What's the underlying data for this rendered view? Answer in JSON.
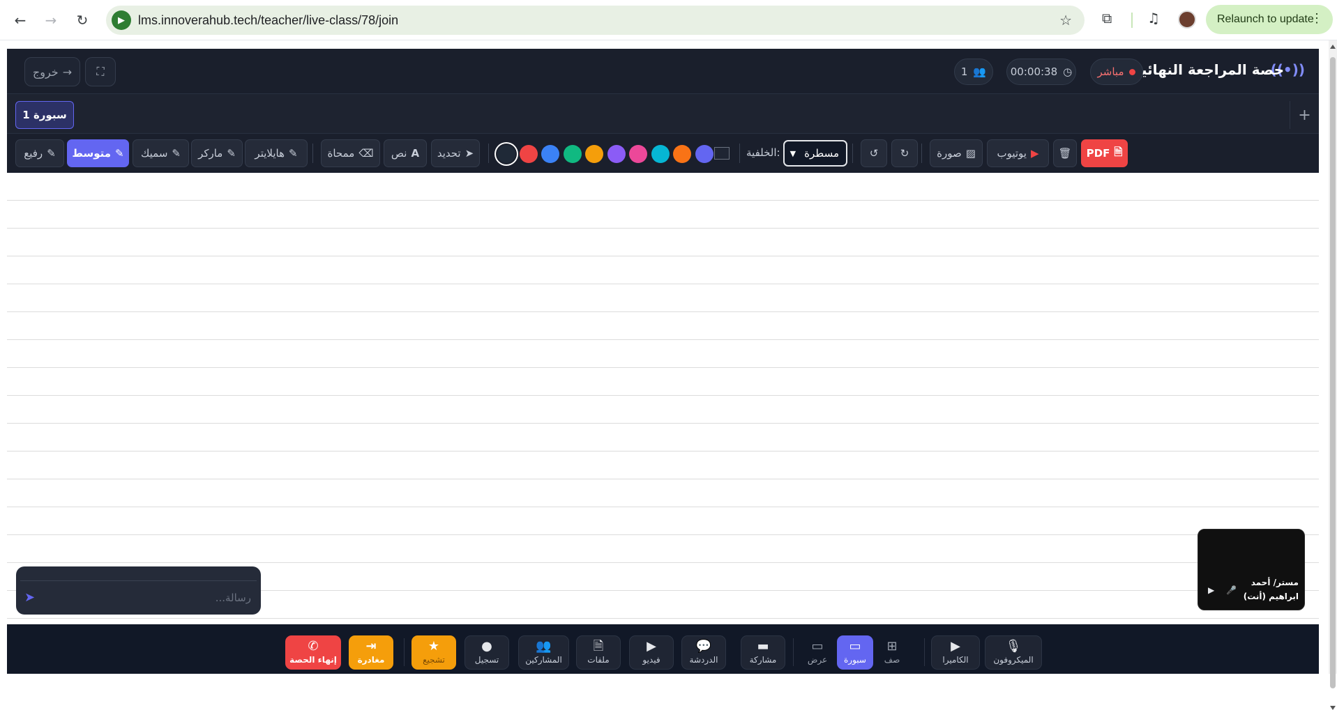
{
  "browser": {
    "url": "lms.innoverahub.tech/teacher/live-class/78/join",
    "relaunch_label": "Relaunch to update"
  },
  "header": {
    "title": "حصة المراجعة النهائية",
    "live_label": "مباشر",
    "timer": "00:00:38",
    "participants_count": "1",
    "exit_label": "خروج"
  },
  "tabs": {
    "active_tab": "سبورة 1",
    "add_label": "+"
  },
  "toolbar": {
    "pdf_label": "PDF",
    "youtube_label": "يوتيوب",
    "image_label": "صورة",
    "background_label": ":الخلفية",
    "background_value": "مسطرة",
    "colors": [
      "#1f2937",
      "#ef4444",
      "#3b82f6",
      "#10b981",
      "#f59e0b",
      "#8b5cf6",
      "#ec4899",
      "#06b6d4",
      "#f97316",
      "#6366f1"
    ],
    "select_label": "تحديد",
    "text_label": "نص",
    "eraser_label": "ممحاة",
    "highlighter_label": "هايلايتر",
    "marker_label": "ماركر",
    "thick_label": "سميك",
    "medium_label": "متوسط",
    "thin_label": "رفيع"
  },
  "chat": {
    "placeholder": "رسالة..."
  },
  "video": {
    "name_line1": "مستر/ أحمد",
    "name_line2": "ابراهيم (أنت)"
  },
  "bottom": {
    "mic_label": "الميكروفون",
    "camera_label": "الكاميرا",
    "row_label": "صف",
    "board_label": "سبورة",
    "view_label": "عرض",
    "share_label": "مشاركة",
    "chat_label": "الدردشة",
    "video_label": "فيديو",
    "files_label": "ملفات",
    "participants_label": "المشاركين",
    "record_label": "تسجيل",
    "encourage_label": "تشجيع",
    "leave_label": "مغادرة",
    "end_label": "إنهاء الحصة"
  }
}
